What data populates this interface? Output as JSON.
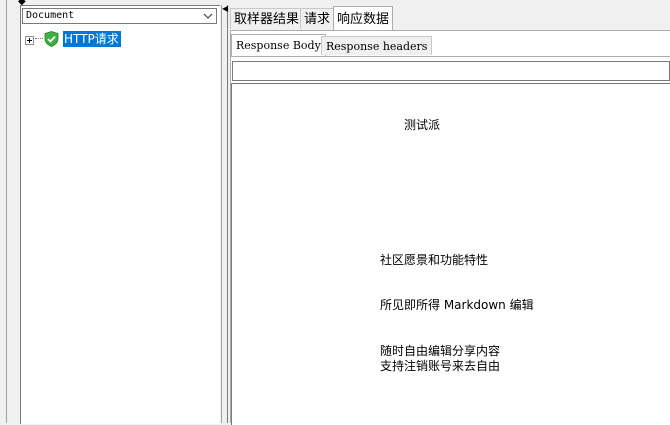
{
  "tree": {
    "view_select": "Document",
    "root_item": {
      "label": "HTTP请求",
      "status": "success",
      "icon": "shield-check-icon"
    }
  },
  "tabs": [
    {
      "label": "取样器结果",
      "active": false
    },
    {
      "label": "请求",
      "active": false
    },
    {
      "label": "响应数据",
      "active": true
    }
  ],
  "subtabs": [
    {
      "label": "Response Body",
      "active": true
    },
    {
      "label": "Response headers",
      "active": false
    }
  ],
  "search": {
    "value": ""
  },
  "response_body": {
    "title": "测试派",
    "lines": [
      "社区愿景和功能特性",
      "所见即所得 Markdown 编辑",
      "随时自由编辑分享内容",
      "支持注销账号来去自由"
    ]
  },
  "colors": {
    "selection": "#0078d7",
    "shield_green": "#3cb043",
    "border": "#7a7a7a"
  }
}
